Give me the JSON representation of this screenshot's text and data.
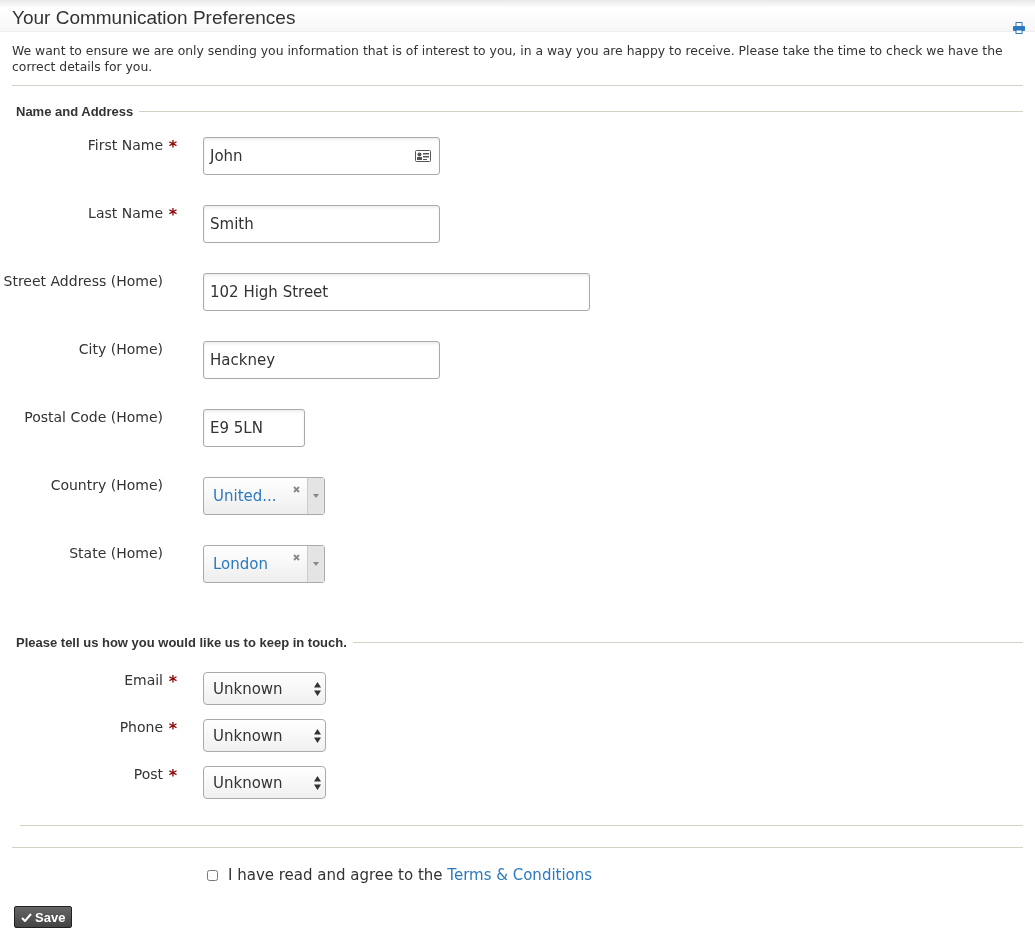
{
  "header": {
    "title": "Your Communication Preferences",
    "intro": "We want to ensure we are only sending you information that is of interest to you, in a way you are happy to receive. Please take the time to check we have the correct details for you."
  },
  "sections": [
    {
      "legend": "Name and Address",
      "fields": [
        {
          "kind": "text",
          "label": "First Name",
          "required_mark": "*",
          "value": "John",
          "autofill": true
        },
        {
          "kind": "text",
          "label": "Last Name",
          "required_mark": "*",
          "value": "Smith",
          "autofill": false
        },
        {
          "kind": "wide_text",
          "label": "Street Address (Home)",
          "value": "102 High Street",
          "autofill": false
        },
        {
          "kind": "text",
          "label": "City (Home)",
          "value": "Hackney",
          "autofill": false
        },
        {
          "kind": "short_text",
          "label": "Postal Code (Home)",
          "value": "E9 5LN",
          "autofill": false
        },
        {
          "kind": "combo",
          "label": "Country (Home)",
          "value": "United..."
        },
        {
          "kind": "combo",
          "label": "State (Home)",
          "value": "London"
        }
      ]
    },
    {
      "legend": "Please tell us how you would like us to keep in touch.",
      "fields": [
        {
          "kind": "select",
          "label": "Email",
          "required_mark": "*",
          "value": "Unknown"
        },
        {
          "kind": "select",
          "label": "Phone",
          "required_mark": "*",
          "value": "Unknown"
        },
        {
          "kind": "select",
          "label": "Post",
          "required_mark": "*",
          "value": "Unknown"
        }
      ]
    }
  ],
  "agreement": {
    "checked": false,
    "text": "I have read and agree to the",
    "link": "Terms & Conditions"
  },
  "save_button": "Save"
}
